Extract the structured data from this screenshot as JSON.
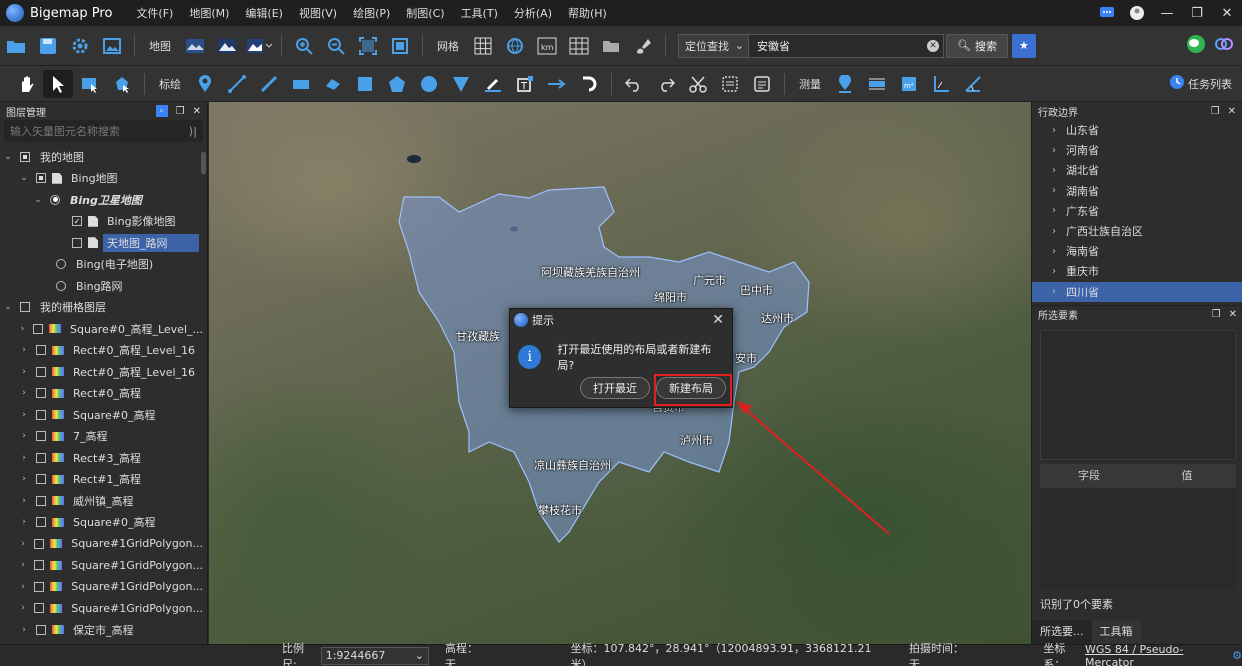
{
  "app": {
    "name": "Bigemap Pro",
    "menu": [
      "文件(F)",
      "地图(M)",
      "编辑(E)",
      "视图(V)",
      "绘图(P)",
      "制图(C)",
      "工具(T)",
      "分析(A)",
      "帮助(H)"
    ]
  },
  "toolbar1": {
    "map_label": "地图",
    "grid_label": "网格",
    "locate_mode": "定位查找",
    "search_value": "安徽省",
    "search_button": "搜索"
  },
  "toolbar2": {
    "annotate_label": "标绘",
    "measure_label": "测量",
    "task_list": "任务列表"
  },
  "layers": {
    "title": "图层管理",
    "filter_placeholder": "输入矢量图元名称搜索",
    "rows": [
      {
        "label": "我的地图"
      },
      {
        "label": "Bing地图"
      },
      {
        "label": "Bing卫星地图"
      },
      {
        "label": "Bing影像地图"
      },
      {
        "label": "天地图_路网"
      },
      {
        "label": "Bing(电子地图)"
      },
      {
        "label": "Bing路网"
      },
      {
        "label": "我的栅格图层"
      },
      {
        "label": "Square#0_高程_Level_..."
      },
      {
        "label": "Rect#0_高程_Level_16"
      },
      {
        "label": "Rect#0_高程_Level_16"
      },
      {
        "label": "Rect#0_高程"
      },
      {
        "label": "Square#0_高程"
      },
      {
        "label": "7_高程"
      },
      {
        "label": "Rect#3_高程"
      },
      {
        "label": "Rect#1_高程"
      },
      {
        "label": "威州镇_高程"
      },
      {
        "label": "Square#0_高程"
      },
      {
        "label": "Square#1GridPolygon..."
      },
      {
        "label": "Square#1GridPolygon..."
      },
      {
        "label": "Square#1GridPolygon..."
      },
      {
        "label": "Square#1GridPolygon..."
      },
      {
        "label": "保定市_高程"
      }
    ]
  },
  "map": {
    "labels": [
      "阿坝藏族羌族自治州",
      "广元市",
      "巴中市",
      "绵阳市",
      "达州市",
      "甘孜藏族",
      "安市",
      "自贡市",
      "泸州市",
      "凉山彝族自治州",
      "攀枝花市"
    ]
  },
  "dialog": {
    "title": "提示",
    "message": "打开最近使用的布局或者新建布局?",
    "btn_recent": "打开最近",
    "btn_new": "新建布局"
  },
  "admin": {
    "title": "行政边界",
    "items": [
      "山东省",
      "河南省",
      "湖北省",
      "湖南省",
      "广东省",
      "广西壮族自治区",
      "海南省",
      "重庆市",
      "四川省"
    ]
  },
  "selected_features": {
    "title": "所选要素",
    "col_field": "字段",
    "col_value": "值",
    "recognized": "识别了0个要素",
    "tabs": [
      "所选要...",
      "工具箱"
    ]
  },
  "status": {
    "scale_label": "比例尺:",
    "scale_value": "1:9244667",
    "elev": "高程：无",
    "coords": "坐标：107.842°，28.941°（12004893.91，3368121.21 米）",
    "capture_time": "拍摄时间：无",
    "crs_label": "坐标系：",
    "crs_value": "WGS 84 / Pseudo-Mercator"
  },
  "colors": {
    "accent": "#3c63a8",
    "highlight": "#e02020",
    "info": "#2e7ad6"
  }
}
